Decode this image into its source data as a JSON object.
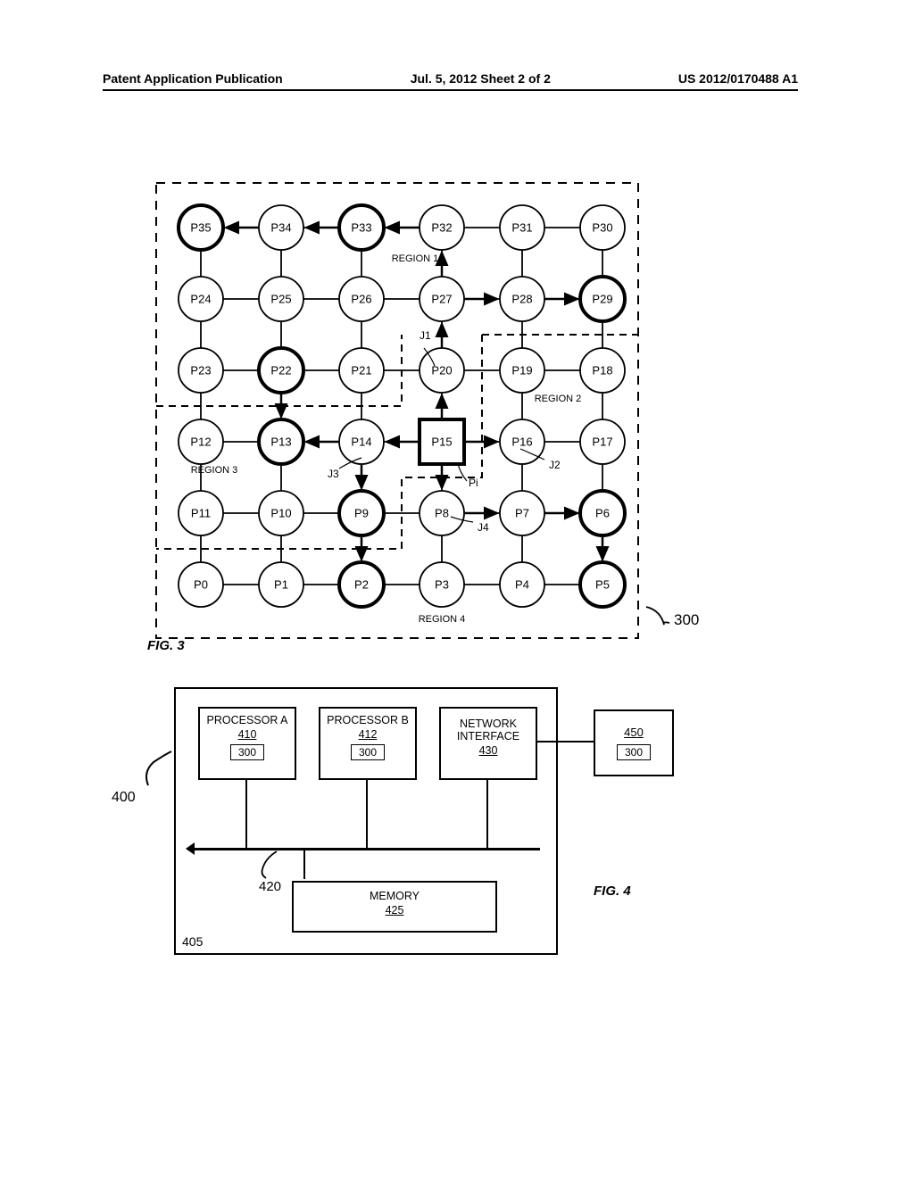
{
  "header": {
    "left": "Patent Application Publication",
    "center": "Jul. 5, 2012  Sheet 2 of 2",
    "right": "US 2012/0170488 A1"
  },
  "fig3": {
    "caption": "FIG. 3",
    "ref": "300",
    "region1": "REGION 1",
    "region2": "REGION 2",
    "region3": "REGION 3",
    "region4": "REGION 4",
    "j1": "J1",
    "j2": "J2",
    "j3": "J3",
    "j4": "J4",
    "pi": "Pi",
    "nodes": [
      "P0",
      "P1",
      "P2",
      "P3",
      "P4",
      "P5",
      "P6",
      "P7",
      "P8",
      "P9",
      "P10",
      "P11",
      "P12",
      "P13",
      "P14",
      "P15",
      "P16",
      "P17",
      "P18",
      "P19",
      "P20",
      "P21",
      "P22",
      "P23",
      "P24",
      "P25",
      "P26",
      "P27",
      "P28",
      "P29",
      "P30",
      "P31",
      "P32",
      "P33",
      "P34",
      "P35"
    ]
  },
  "fig4": {
    "caption": "FIG. 4",
    "ref400": "400",
    "ref420": "420",
    "ref405": "405",
    "procA": {
      "name": "PROCESSOR A",
      "num": "410",
      "inner": "300"
    },
    "procB": {
      "name": "PROCESSOR B",
      "num": "412",
      "inner": "300"
    },
    "net": {
      "name": "NETWORK INTERFACE",
      "num": "430"
    },
    "mem": {
      "name": "MEMORY",
      "num": "425"
    },
    "ext": {
      "num": "450",
      "inner": "300"
    }
  }
}
